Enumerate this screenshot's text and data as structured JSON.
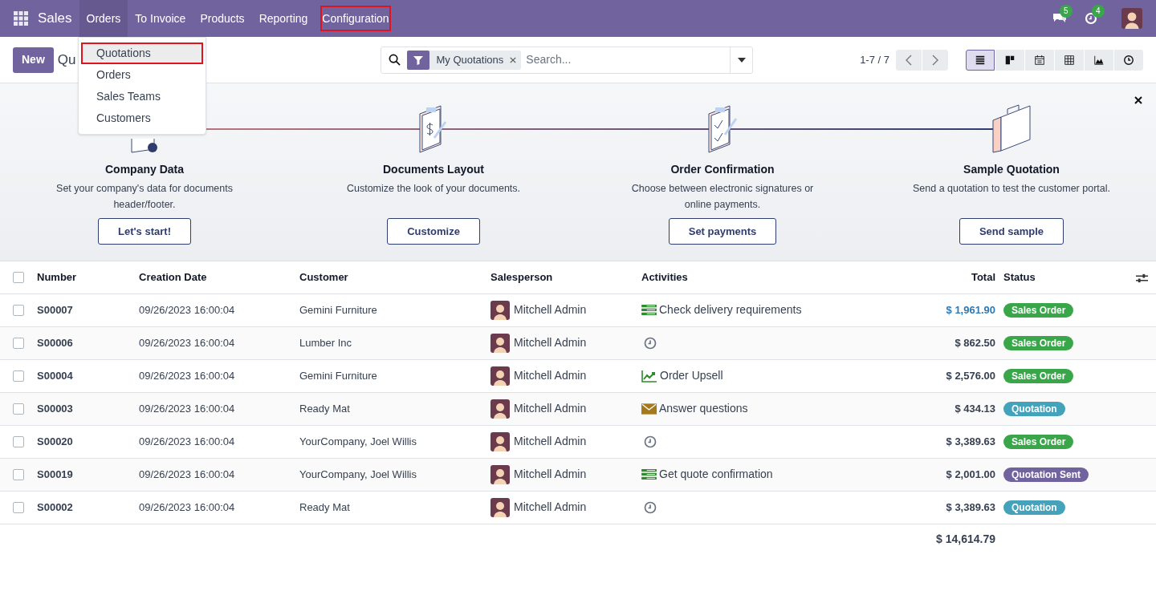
{
  "navbar": {
    "app": "Sales",
    "menus": [
      {
        "label": "Orders",
        "selected": true,
        "annotated": false
      },
      {
        "label": "To Invoice",
        "selected": false,
        "annotated": false
      },
      {
        "label": "Products",
        "selected": false,
        "annotated": false
      },
      {
        "label": "Reporting",
        "selected": false,
        "annotated": false
      },
      {
        "label": "Configuration",
        "selected": false,
        "annotated": true
      }
    ],
    "messages_count": "5",
    "activities_count": "4"
  },
  "dropdown": {
    "items": [
      {
        "label": "Quotations",
        "selected": true,
        "annotated": true
      },
      {
        "label": "Orders",
        "selected": false,
        "annotated": false
      },
      {
        "label": "Sales Teams",
        "selected": false,
        "annotated": false
      },
      {
        "label": "Customers",
        "selected": false,
        "annotated": false
      }
    ]
  },
  "control_panel": {
    "new_button": "New",
    "title": "Qu",
    "filter": "My Quotations",
    "search_placeholder": "Search...",
    "pager": "1-7 / 7",
    "views": [
      {
        "kind": "list",
        "selected": true
      },
      {
        "kind": "kanban",
        "selected": false
      },
      {
        "kind": "calendar",
        "selected": false
      },
      {
        "kind": "pivot",
        "selected": false
      },
      {
        "kind": "graph",
        "selected": false
      },
      {
        "kind": "activity",
        "selected": false
      }
    ]
  },
  "onboarding": {
    "steps": [
      {
        "kind": "company",
        "title": "Company Data",
        "text": "Set your company's data for documents header/footer.",
        "button": "Let's start!"
      },
      {
        "kind": "layout",
        "title": "Documents Layout",
        "text": "Customize the look of your documents.",
        "button": "Customize"
      },
      {
        "kind": "confirmation",
        "title": "Order Confirmation",
        "text": "Choose between electronic signatures or online payments.",
        "button": "Set payments"
      },
      {
        "kind": "sample",
        "title": "Sample Quotation",
        "text": "Send a quotation to test the customer portal.",
        "button": "Send sample"
      }
    ]
  },
  "table": {
    "columns": [
      "Number",
      "Creation Date",
      "Customer",
      "Salesperson",
      "Activities",
      "Total",
      "Status"
    ],
    "select_all_checked": false,
    "rows": [
      {
        "checked": false,
        "number": "S00007",
        "date": "09/26/2023 16:00:04",
        "customer": "Gemini Furniture",
        "salesperson": "Mitchell Admin",
        "activity": {
          "kind": "todo",
          "summary": "Check delivery requirements"
        },
        "total": "$ 1,961.90",
        "total_highlighted": true,
        "status": {
          "label": "Sales Order",
          "color": "#3aa64a"
        }
      },
      {
        "checked": false,
        "number": "S00006",
        "date": "09/26/2023 16:00:04",
        "customer": "Lumber Inc",
        "salesperson": "Mitchell Admin",
        "activity": {
          "kind": "none"
        },
        "total": "$ 862.50",
        "total_highlighted": false,
        "status": {
          "label": "Sales Order",
          "color": "#3aa64a"
        }
      },
      {
        "checked": false,
        "number": "S00004",
        "date": "09/26/2023 16:00:04",
        "customer": "Gemini Furniture",
        "salesperson": "Mitchell Admin",
        "activity": {
          "kind": "upsell",
          "summary": "Order Upsell"
        },
        "total": "$ 2,576.00",
        "total_highlighted": false,
        "status": {
          "label": "Sales Order",
          "color": "#3aa64a"
        }
      },
      {
        "checked": false,
        "number": "S00003",
        "date": "09/26/2023 16:00:04",
        "customer": "Ready Mat",
        "salesperson": "Mitchell Admin",
        "activity": {
          "kind": "email",
          "summary": "Answer questions"
        },
        "total": "$ 434.13",
        "total_highlighted": false,
        "status": {
          "label": "Quotation",
          "color": "#44a2ba"
        }
      },
      {
        "checked": false,
        "number": "S00020",
        "date": "09/26/2023 16:00:04",
        "customer": "YourCompany, Joel Willis",
        "salesperson": "Mitchell Admin",
        "activity": {
          "kind": "none"
        },
        "total": "$ 3,389.63",
        "total_highlighted": false,
        "status": {
          "label": "Sales Order",
          "color": "#3aa64a"
        }
      },
      {
        "checked": false,
        "number": "S00019",
        "date": "09/26/2023 16:00:04",
        "customer": "YourCompany, Joel Willis",
        "salesperson": "Mitchell Admin",
        "activity": {
          "kind": "todo",
          "summary": "Get quote confirmation"
        },
        "total": "$ 2,001.00",
        "total_highlighted": false,
        "status": {
          "label": "Quotation Sent",
          "color": "#71639e"
        }
      },
      {
        "checked": false,
        "number": "S00002",
        "date": "09/26/2023 16:00:04",
        "customer": "Ready Mat",
        "salesperson": "Mitchell Admin",
        "activity": {
          "kind": "none"
        },
        "total": "$ 3,389.63",
        "total_highlighted": false,
        "status": {
          "label": "Quotation",
          "color": "#44a2ba"
        }
      }
    ],
    "grand_total": "$ 14,614.79"
  }
}
